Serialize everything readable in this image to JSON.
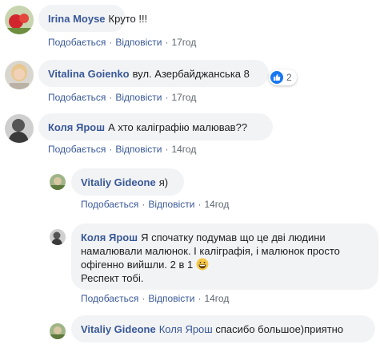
{
  "actions": {
    "like": "Подобається",
    "reply": "Відповісти"
  },
  "comments": [
    {
      "author": "Irina Moyse",
      "text": "Круто !!!",
      "time": "17год"
    },
    {
      "author": "Vitalina Goienko",
      "text": "вул. Азербайджанська 8",
      "time": "17год",
      "reaction_count": "2",
      "reaction_icon": "like-icon"
    },
    {
      "author": "Коля Ярош",
      "text": "А хто каліграфію малював??",
      "time": "14год"
    },
    {
      "author": "Vitaliy Gideone",
      "text": "я)",
      "time": "14год"
    },
    {
      "author": "Коля Ярош",
      "text": "Я спочатку подумав що це дві людини намалювали малюнок. І каліграфія, і малюнок просто офігенно вийшли. 2 в 1",
      "text2": "Респект тобі.",
      "emoji": "grinning-face-icon",
      "time": "14год"
    },
    {
      "author": "Vitaliy Gideone",
      "mention": "Коля Ярош",
      "text": "спасибо большое)приятно"
    }
  ],
  "colors": {
    "author": "#385898",
    "bubble": "#f2f3f5",
    "like": "#1877f2",
    "meta": "#606770"
  }
}
